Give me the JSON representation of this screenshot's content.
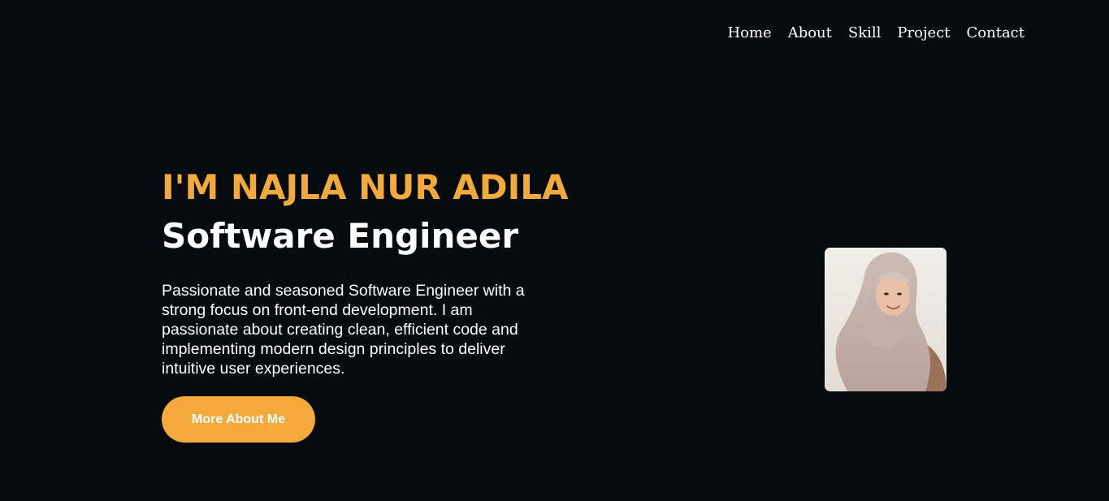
{
  "nav": {
    "items": [
      {
        "label": "Home"
      },
      {
        "label": "About"
      },
      {
        "label": "Skill"
      },
      {
        "label": "Project"
      },
      {
        "label": "Contact"
      }
    ]
  },
  "hero": {
    "name": "I'M NAJLA NUR ADILA",
    "role": "Software Engineer",
    "description": "Passionate and seasoned Software Engineer with a strong focus on front-end development. I am passionate about creating clean, efficient code and implementing modern design principles to deliver intuitive user experiences.",
    "cta_label": "More About Me"
  },
  "colors": {
    "background": "#050b0e",
    "accent": "#f4a93b",
    "text": "#ffffff"
  }
}
